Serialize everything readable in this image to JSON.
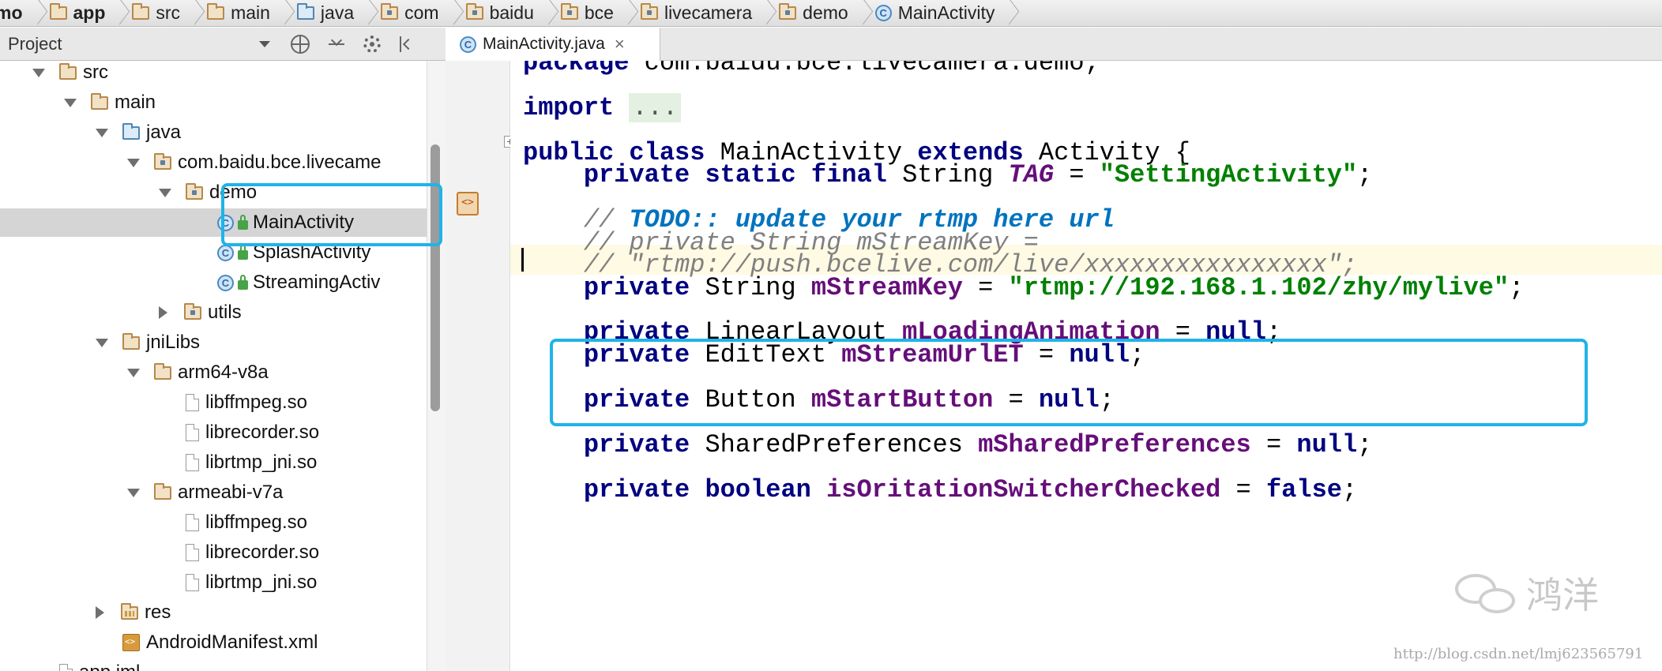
{
  "breadcrumb": [
    {
      "label": "mo",
      "icon": "module-icon",
      "bold": true
    },
    {
      "label": "app",
      "icon": "folder-icon",
      "bold": true
    },
    {
      "label": "src",
      "icon": "folder-icon"
    },
    {
      "label": "main",
      "icon": "folder-icon"
    },
    {
      "label": "java",
      "icon": "source-folder-icon"
    },
    {
      "label": "com",
      "icon": "package-icon"
    },
    {
      "label": "baidu",
      "icon": "package-icon"
    },
    {
      "label": "bce",
      "icon": "package-icon"
    },
    {
      "label": "livecamera",
      "icon": "package-icon"
    },
    {
      "label": "demo",
      "icon": "package-icon"
    },
    {
      "label": "MainActivity",
      "icon": "class-icon"
    }
  ],
  "project_panel": {
    "title": "Project",
    "tools": [
      "scroll-from-source-icon",
      "collapse-all-icon",
      "settings-gear-icon",
      "hide-panel-icon"
    ]
  },
  "tree": [
    {
      "label": "src",
      "icon": "folder",
      "arrow": "down",
      "selected": false
    },
    {
      "label": "main",
      "icon": "folder",
      "arrow": "down",
      "selected": false
    },
    {
      "label": "java",
      "icon": "source-folder",
      "arrow": "down",
      "selected": false
    },
    {
      "label": "com.baidu.bce.livecame",
      "icon": "package",
      "arrow": "down",
      "selected": false
    },
    {
      "label": "demo",
      "icon": "package",
      "arrow": "down",
      "selected": false
    },
    {
      "label": "MainActivity",
      "icon": "class",
      "arrow": "none",
      "selected": true
    },
    {
      "label": "SplashActivity",
      "icon": "class",
      "arrow": "none",
      "selected": false
    },
    {
      "label": "StreamingActiv",
      "icon": "class",
      "arrow": "none",
      "selected": false
    },
    {
      "label": "utils",
      "icon": "package",
      "arrow": "right",
      "selected": false
    },
    {
      "label": "jniLibs",
      "icon": "folder",
      "arrow": "down",
      "selected": false
    },
    {
      "label": "arm64-v8a",
      "icon": "folder",
      "arrow": "down",
      "selected": false
    },
    {
      "label": "libffmpeg.so",
      "icon": "file",
      "arrow": "none",
      "selected": false
    },
    {
      "label": "librecorder.so",
      "icon": "file",
      "arrow": "none",
      "selected": false
    },
    {
      "label": "librtmp_jni.so",
      "icon": "file",
      "arrow": "none",
      "selected": false
    },
    {
      "label": "armeabi-v7a",
      "icon": "folder",
      "arrow": "down",
      "selected": false
    },
    {
      "label": "libffmpeg.so",
      "icon": "file",
      "arrow": "none",
      "selected": false
    },
    {
      "label": "librecorder.so",
      "icon": "file",
      "arrow": "none",
      "selected": false
    },
    {
      "label": "librtmp_jni.so",
      "icon": "file",
      "arrow": "none",
      "selected": false
    },
    {
      "label": "res",
      "icon": "res-folder",
      "arrow": "right",
      "selected": false
    },
    {
      "label": "AndroidManifest.xml",
      "icon": "xml",
      "arrow": "none",
      "selected": false
    },
    {
      "label": "app.iml",
      "icon": "file",
      "arrow": "none",
      "selected": false
    }
  ],
  "editor": {
    "tab_title": "MainActivity.java",
    "tab_close": "×",
    "gutter_override_icon": "<>",
    "code_lines": [
      [
        [
          "kw",
          "package"
        ],
        [
          "plain",
          " com.baidu.bce.livecamera.demo;"
        ]
      ],
      [],
      [
        [
          "kw",
          "import"
        ],
        [
          "plain",
          " "
        ],
        [
          "fold",
          "..."
        ]
      ],
      [],
      [
        [
          "kw",
          "public class"
        ],
        [
          "plain",
          " MainActivity "
        ],
        [
          "kw",
          "extends"
        ],
        [
          "plain",
          " Activity {"
        ]
      ],
      [
        [
          "plain",
          "    "
        ],
        [
          "kw",
          "private static final"
        ],
        [
          "plain",
          " String "
        ],
        [
          "sfld",
          "TAG"
        ],
        [
          "plain",
          " = "
        ],
        [
          "str",
          "\"SettingActivity\""
        ],
        [
          "plain",
          ";"
        ]
      ],
      [],
      [
        [
          "plain",
          "    "
        ],
        [
          "cmt",
          "// "
        ],
        [
          "todo",
          "TODO:: update your rtmp here url"
        ]
      ],
      [
        [
          "plain",
          "    "
        ],
        [
          "cmt",
          "// private String mStreamKey ="
        ]
      ],
      [
        [
          "plain",
          "    "
        ],
        [
          "cmt",
          "// \"rtmp://push.bcelive.com/live/xxxxxxxxxxxxxxxx\";"
        ]
      ],
      [
        [
          "plain",
          "    "
        ],
        [
          "kw",
          "private"
        ],
        [
          "plain",
          " String "
        ],
        [
          "fld",
          "mStreamKey"
        ],
        [
          "plain",
          " = "
        ],
        [
          "str",
          "\"rtmp://192.168.1.102/zhy/mylive\""
        ],
        [
          "plain",
          ";"
        ]
      ],
      [],
      [
        [
          "plain",
          "    "
        ],
        [
          "kw",
          "private"
        ],
        [
          "plain",
          " LinearLayout "
        ],
        [
          "fld",
          "mLoadingAnimation"
        ],
        [
          "plain",
          " = "
        ],
        [
          "kw",
          "null"
        ],
        [
          "plain",
          ";"
        ]
      ],
      [
        [
          "plain",
          "    "
        ],
        [
          "kw",
          "private"
        ],
        [
          "plain",
          " EditText "
        ],
        [
          "fld",
          "mStreamUrlET"
        ],
        [
          "plain",
          " = "
        ],
        [
          "kw",
          "null"
        ],
        [
          "plain",
          ";"
        ]
      ],
      [],
      [
        [
          "plain",
          "    "
        ],
        [
          "kw",
          "private"
        ],
        [
          "plain",
          " Button "
        ],
        [
          "fld",
          "mStartButton"
        ],
        [
          "plain",
          " = "
        ],
        [
          "kw",
          "null"
        ],
        [
          "plain",
          ";"
        ]
      ],
      [],
      [
        [
          "plain",
          "    "
        ],
        [
          "kw",
          "private"
        ],
        [
          "plain",
          " SharedPreferences "
        ],
        [
          "fld",
          "mSharedPreferences"
        ],
        [
          "plain",
          " = "
        ],
        [
          "kw",
          "null"
        ],
        [
          "plain",
          ";"
        ]
      ],
      [],
      [
        [
          "plain",
          "    "
        ],
        [
          "kw",
          "private boolean"
        ],
        [
          "plain",
          " "
        ],
        [
          "fld",
          "isOritationSwitcherChecked"
        ],
        [
          "plain",
          " = "
        ],
        [
          "kw",
          "false"
        ],
        [
          "plain",
          ";"
        ]
      ]
    ]
  },
  "watermark": {
    "name": "鸿洋",
    "url": "http://blog.csdn.net/lmj623565791"
  },
  "colors": {
    "highlight_box": "#1eb4e8",
    "keyword": "#000080",
    "string": "#008000",
    "field": "#660e7a",
    "comment": "#808080",
    "todo": "#0073bf"
  }
}
